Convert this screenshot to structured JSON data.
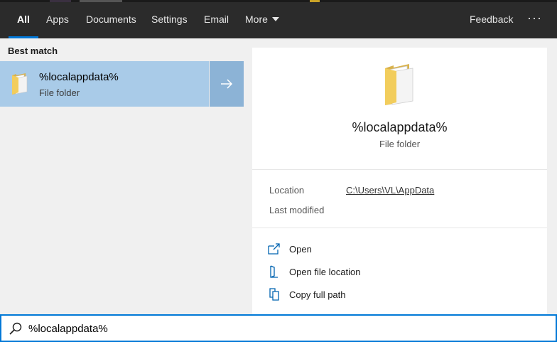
{
  "tabs": [
    {
      "label": "All",
      "active": true
    },
    {
      "label": "Apps"
    },
    {
      "label": "Documents"
    },
    {
      "label": "Settings"
    },
    {
      "label": "Email"
    },
    {
      "label": "More"
    }
  ],
  "header": {
    "feedback_label": "Feedback",
    "overflow_label": "···"
  },
  "best_match": {
    "heading": "Best match",
    "title": "%localappdata%",
    "subtitle": "File folder"
  },
  "details": {
    "title": "%localappdata%",
    "subtitle": "File folder",
    "location_label": "Location",
    "location_value": "C:\\Users\\VL\\AppData",
    "last_modified_label": "Last modified"
  },
  "actions": [
    {
      "label": "Open",
      "icon": "open-icon"
    },
    {
      "label": "Open file location",
      "icon": "file-location-icon"
    },
    {
      "label": "Copy full path",
      "icon": "copy-icon"
    }
  ],
  "search": {
    "value": "%localappdata%"
  },
  "colors": {
    "accent": "#0078d7",
    "selection": "#a9cbe8",
    "topbar": "#2b2b2b"
  }
}
